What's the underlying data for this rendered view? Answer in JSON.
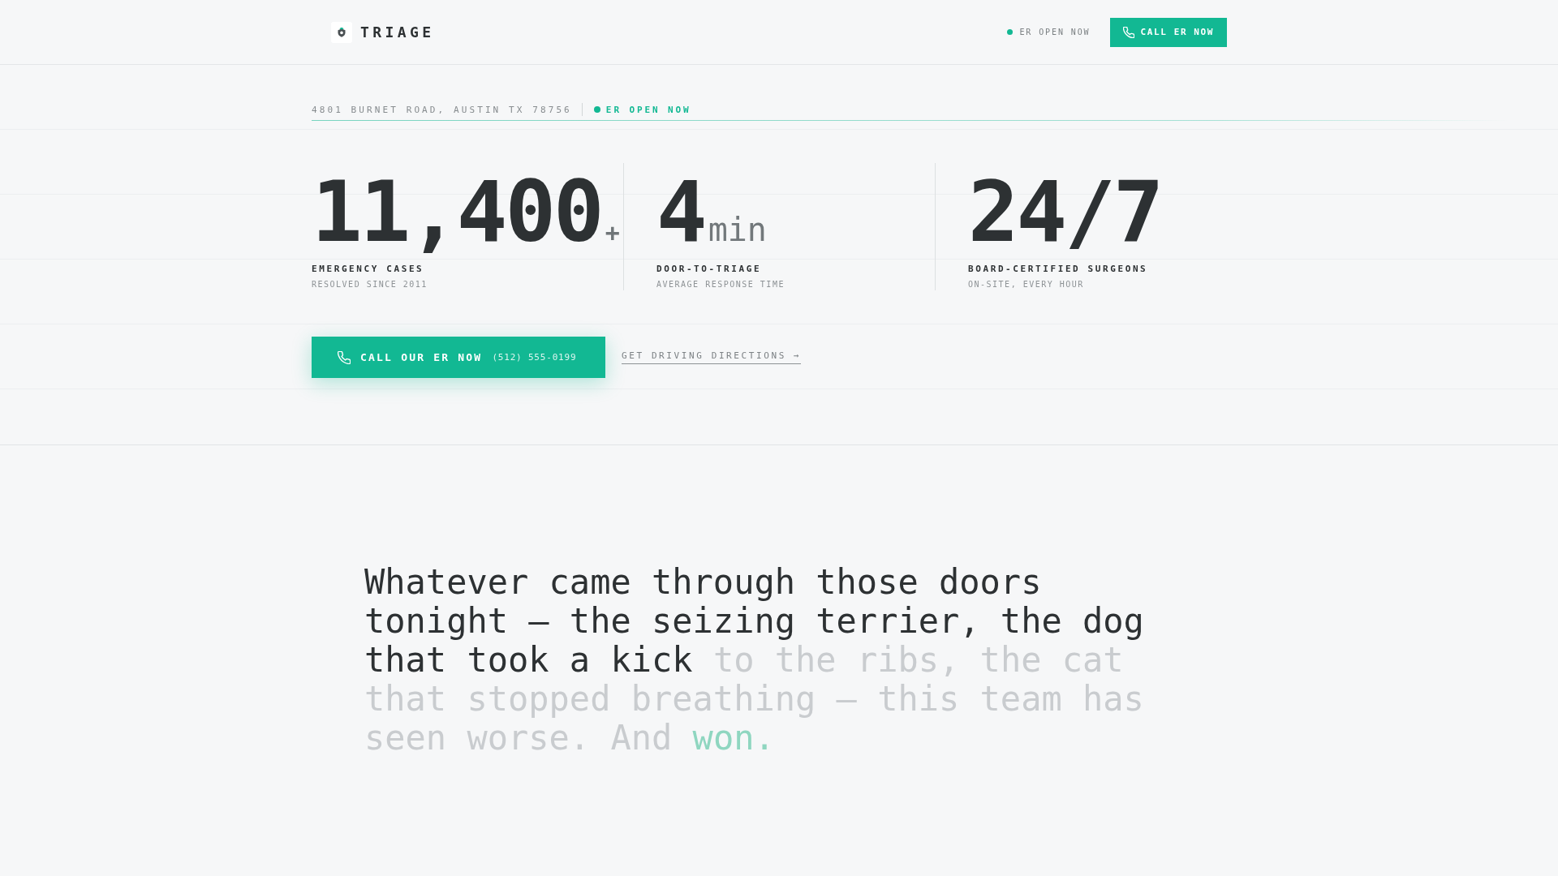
{
  "header": {
    "brand": "TRIAGE",
    "status": "ER OPEN NOW",
    "button": "CALL ER NOW"
  },
  "hero": {
    "address": "4801 BURNET ROAD, AUSTIN TX 78756",
    "status": "ER OPEN NOW",
    "stats": [
      {
        "value": "11,400",
        "suffix": "+",
        "label": "EMERGENCY CASES",
        "caption": "RESOLVED SINCE 2011"
      },
      {
        "value": "4",
        "unit": "min",
        "label": "DOOR-TO-TRIAGE",
        "caption": "AVERAGE RESPONSE TIME"
      },
      {
        "value": "24/7",
        "label": "BOARD-CERTIFIED SURGEONS",
        "caption": "ON-SITE, EVERY HOUR"
      }
    ],
    "cta": {
      "label": "CALL OUR ER NOW",
      "phone": "(512) 555-0199"
    },
    "link": "GET DRIVING DIRECTIONS →"
  },
  "quote": {
    "segments": [
      {
        "text": "Whatever came through those doors tonight — the seizing terrier, the dog that took a kick",
        "revealed": true,
        "accent": false
      },
      {
        "text": "to the ribs, the cat that stopped breathing — this team has seen worse. And",
        "revealed": false,
        "accent": false
      },
      {
        "text": "won.",
        "revealed": false,
        "accent": true
      }
    ]
  }
}
